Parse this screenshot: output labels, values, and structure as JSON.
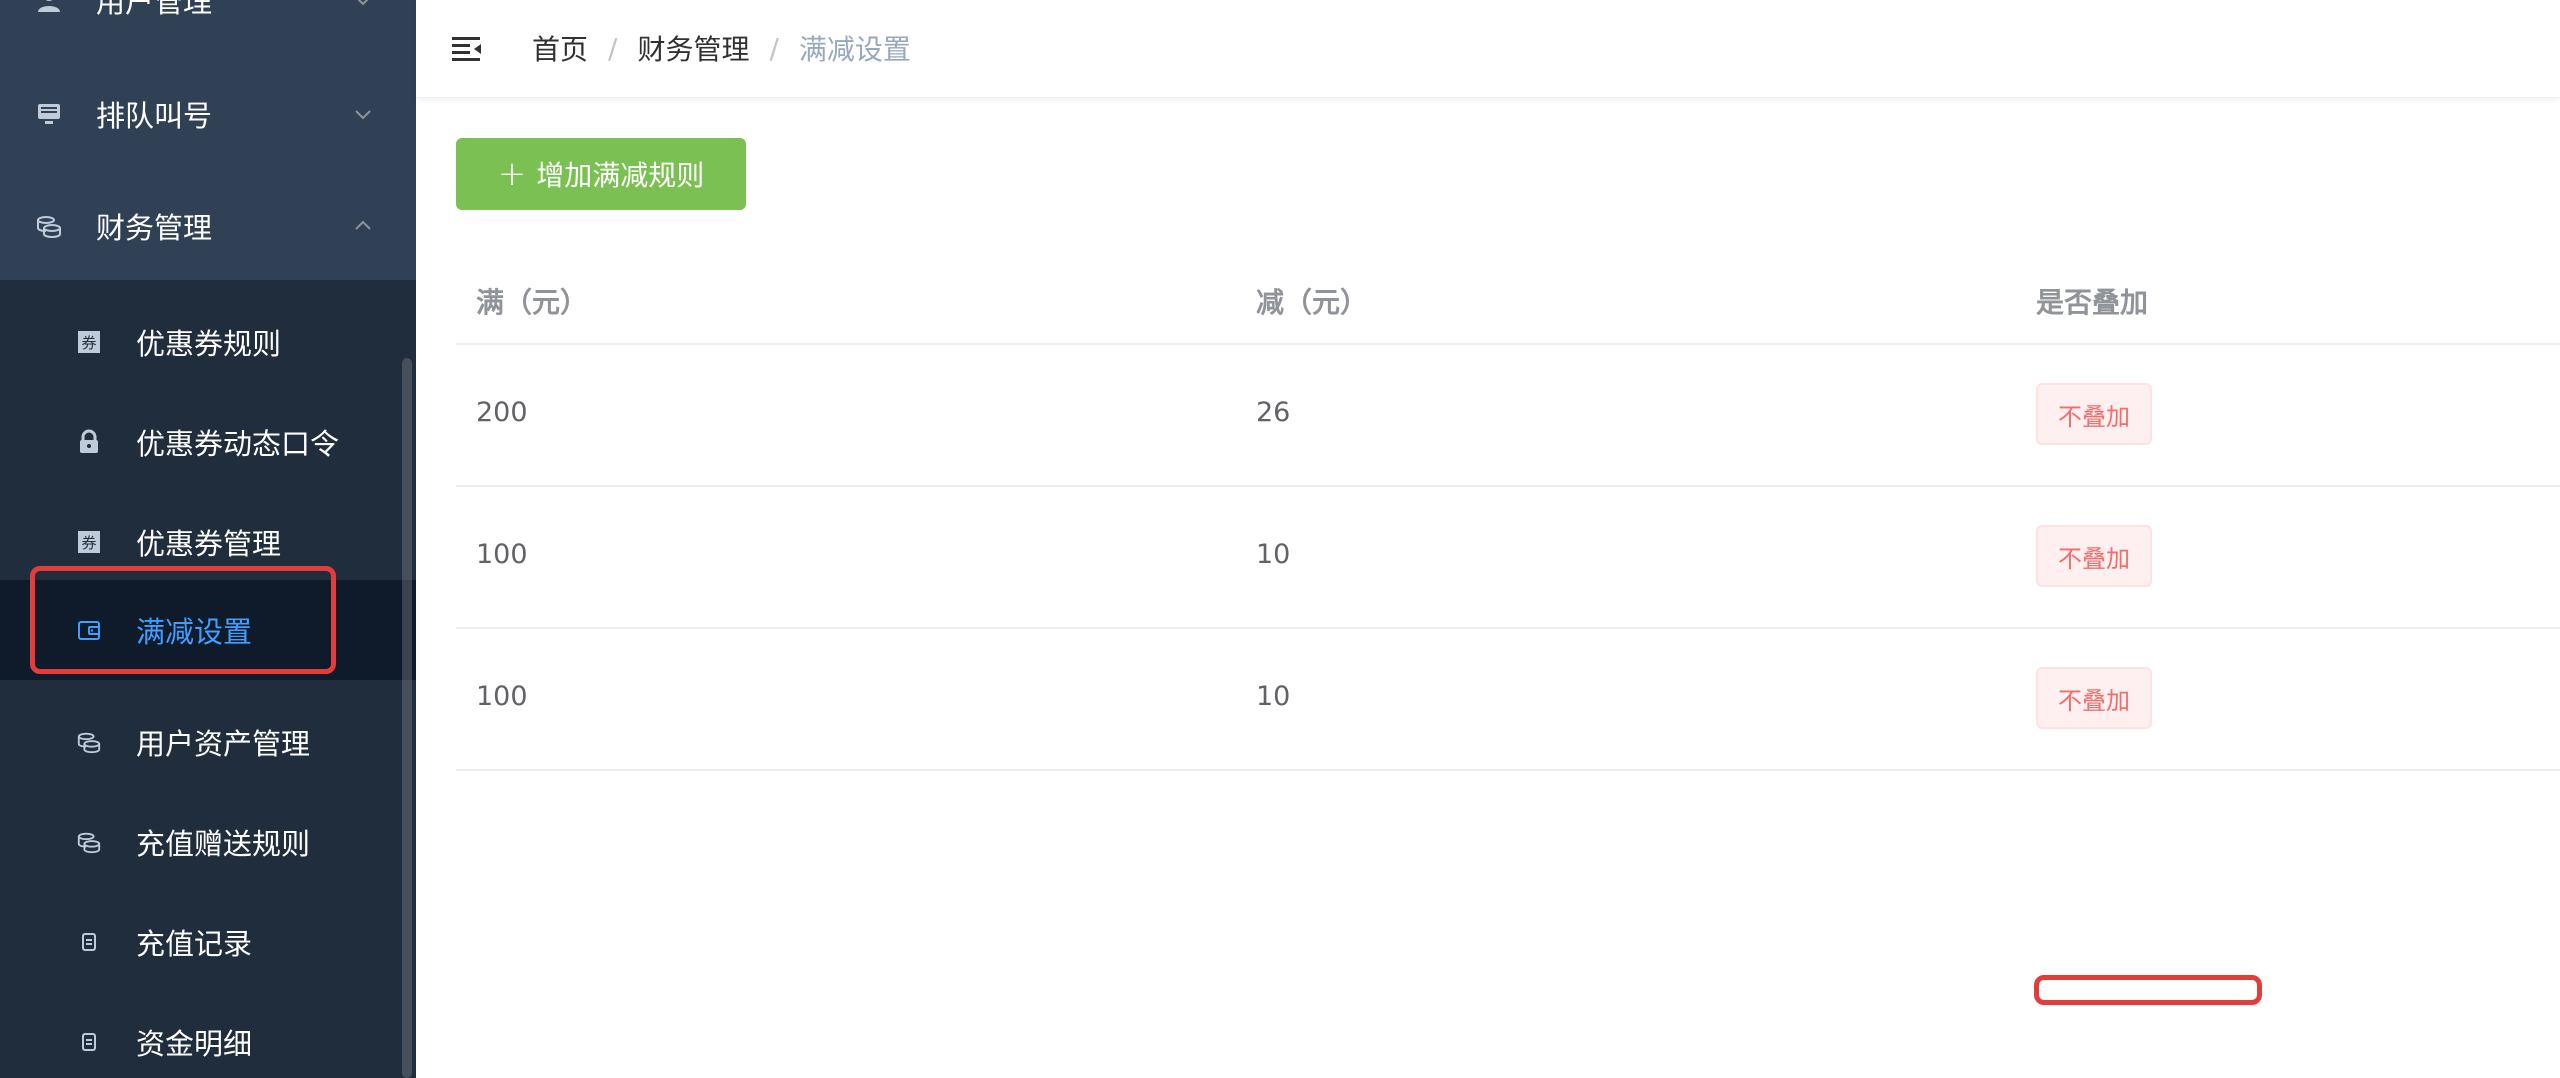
{
  "sidebar": {
    "menus": [
      {
        "label": "用户管理",
        "icon": "user-icon",
        "expanded": false
      },
      {
        "label": "排队叫号",
        "icon": "monitor-icon",
        "expanded": false
      },
      {
        "label": "财务管理",
        "icon": "coins-icon",
        "expanded": true
      }
    ],
    "submenu": [
      {
        "label": "优惠券规则",
        "icon": "coupon-icon",
        "active": false
      },
      {
        "label": "优惠券动态口令",
        "icon": "lock-icon",
        "active": false
      },
      {
        "label": "优惠券管理",
        "icon": "coupon-icon",
        "active": false
      },
      {
        "label": "满减设置",
        "icon": "wallet-icon",
        "active": true
      },
      {
        "label": "用户资产管理",
        "icon": "coins-icon",
        "active": false
      },
      {
        "label": "充值赠送规则",
        "icon": "coins-icon",
        "active": false
      },
      {
        "label": "充值记录",
        "icon": "receipt-icon",
        "active": false
      },
      {
        "label": "资金明细",
        "icon": "receipt-icon",
        "active": false
      }
    ]
  },
  "header": {
    "breadcrumb": [
      "首页",
      "财务管理",
      "满减设置"
    ],
    "separator": "/"
  },
  "main": {
    "add_button_label": "增加满减规则",
    "add_button_icon": "+",
    "table": {
      "columns": [
        "满（元）",
        "减（元）",
        "是否叠加"
      ],
      "rows": [
        {
          "full": "200",
          "minus": "26",
          "stack": "不叠加"
        },
        {
          "full": "100",
          "minus": "10",
          "stack": "不叠加"
        },
        {
          "full": "100",
          "minus": "10",
          "stack": "不叠加"
        }
      ]
    }
  },
  "colors": {
    "sidebar_bg": "#304156",
    "submenu_bg": "#1f2d3d",
    "active_text": "#409eff",
    "add_button": "#7ac052",
    "tag_text": "#f56c6c",
    "highlight": "#e23c3c"
  }
}
